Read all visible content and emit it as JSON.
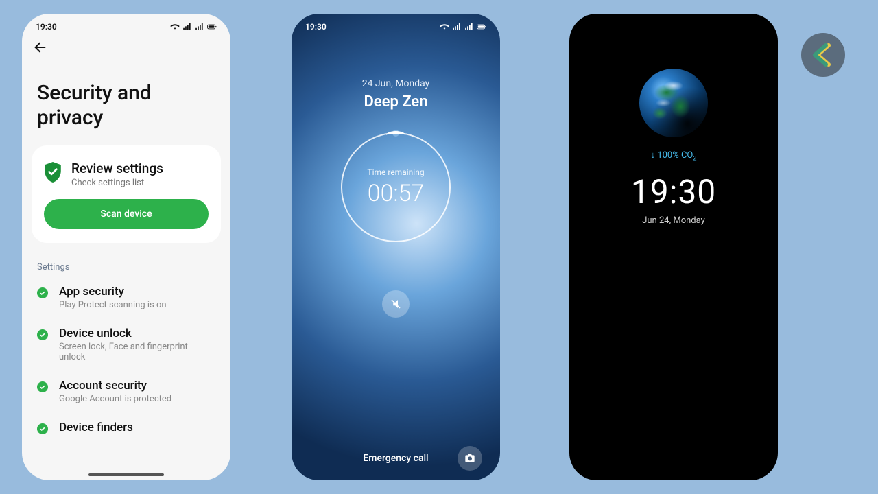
{
  "statusbar": {
    "time": "19:30"
  },
  "phone1": {
    "title": "Security and privacy",
    "review": {
      "title": "Review settings",
      "subtitle": "Check settings list"
    },
    "scan_button": "Scan device",
    "section_label": "Settings",
    "items": [
      {
        "title": "App security",
        "subtitle": "Play Protect scanning is on"
      },
      {
        "title": "Device unlock",
        "subtitle": "Screen lock, Face and fingerprint unlock"
      },
      {
        "title": "Account security",
        "subtitle": "Google Account is protected"
      },
      {
        "title": "Device finders",
        "subtitle": ""
      }
    ]
  },
  "phone2": {
    "date": "24 Jun, Monday",
    "mode": "Deep Zen",
    "remaining_label": "Time remaining",
    "remaining_time": "00:57",
    "emergency": "Emergency call"
  },
  "phone3": {
    "co2_prefix": "↓ 100% CO",
    "co2_sub": "2",
    "time": "19:30",
    "date": "Jun 24, Monday"
  }
}
